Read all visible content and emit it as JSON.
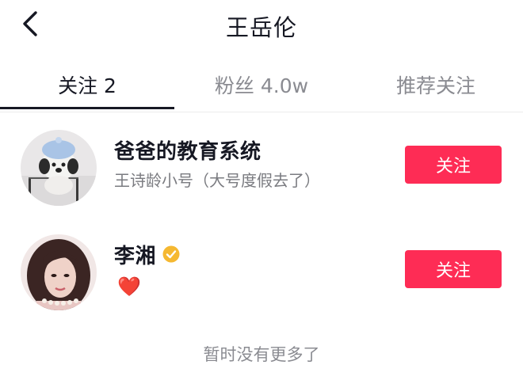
{
  "header": {
    "title": "王岳伦",
    "back_icon": "chevron-left-icon"
  },
  "tabs": [
    {
      "label": "关注 2",
      "active": true
    },
    {
      "label": "粉丝 4.0w",
      "active": false
    },
    {
      "label": "推荐关注",
      "active": false
    }
  ],
  "users": [
    {
      "name": "爸爸的教育系统",
      "subtitle": "王诗龄小号（大号度假去了）",
      "verified": false,
      "follow_label": "关注"
    },
    {
      "name": "李湘",
      "subtitle": "❤️",
      "verified": true,
      "follow_label": "关注"
    }
  ],
  "footer": {
    "no_more_text": "暂时没有更多了"
  },
  "colors": {
    "accent": "#fe2c55",
    "verify": "#f5b831",
    "text_primary": "#161823",
    "text_secondary": "#8a8b91"
  }
}
